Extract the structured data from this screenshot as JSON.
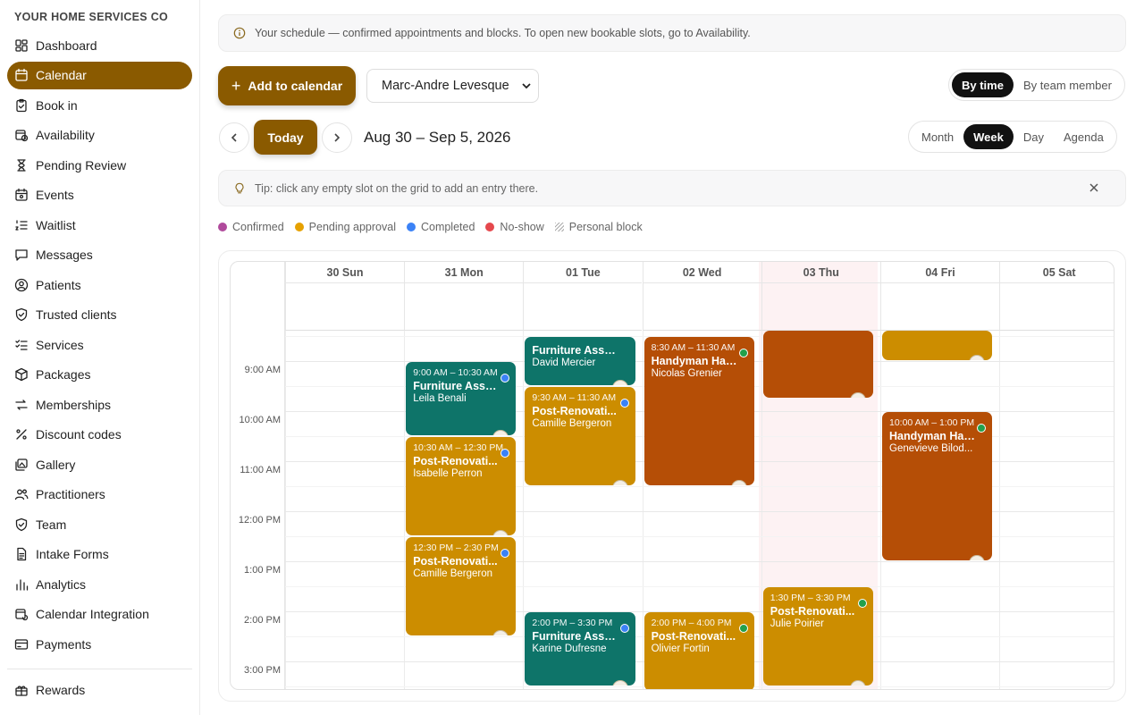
{
  "brand": "YOUR HOME SERVICES CO",
  "sidebar": {
    "items": [
      {
        "label": "Dashboard",
        "icon": "dashboard-icon"
      },
      {
        "label": "Calendar",
        "icon": "calendar-icon",
        "active": true
      },
      {
        "label": "Book in",
        "icon": "clipboard-icon"
      },
      {
        "label": "Availability",
        "icon": "calendar-clock-icon"
      },
      {
        "label": "Pending Review",
        "icon": "hourglass-icon"
      },
      {
        "label": "Events",
        "icon": "calendar-star-icon"
      },
      {
        "label": "Waitlist",
        "icon": "list-ordered-icon"
      },
      {
        "label": "Messages",
        "icon": "chat-icon"
      },
      {
        "label": "Patients",
        "icon": "user-circle-icon"
      },
      {
        "label": "Trusted clients",
        "icon": "shield-check-icon"
      },
      {
        "label": "Services",
        "icon": "list-check-icon"
      },
      {
        "label": "Packages",
        "icon": "package-icon"
      },
      {
        "label": "Memberships",
        "icon": "repeat-icon"
      },
      {
        "label": "Discount codes",
        "icon": "percent-icon"
      },
      {
        "label": "Gallery",
        "icon": "images-icon"
      },
      {
        "label": "Practitioners",
        "icon": "users-icon"
      },
      {
        "label": "Team",
        "icon": "shield-icon"
      },
      {
        "label": "Intake Forms",
        "icon": "document-icon"
      },
      {
        "label": "Analytics",
        "icon": "bar-chart-icon"
      },
      {
        "label": "Calendar Integration",
        "icon": "calendar-sync-icon"
      },
      {
        "label": "Payments",
        "icon": "credit-card-icon"
      }
    ],
    "footer_items": [
      {
        "label": "Rewards",
        "icon": "gift-icon"
      }
    ]
  },
  "info": "Your schedule — confirmed appointments and blocks. To open new bookable slots, go to Availability.",
  "toolbar": {
    "add_label": "Add to calendar",
    "practitioner": "Marc-Andre Levesque",
    "view_mode": [
      "By time",
      "By team member"
    ],
    "view_mode_selected": "By time",
    "today_label": "Today",
    "range": "Aug 30 – Sep 5, 2026",
    "views": [
      "Month",
      "Week",
      "Day",
      "Agenda"
    ],
    "view_selected": "Week"
  },
  "tip": "Tip: click any empty slot on the grid to add an entry there.",
  "legend": [
    {
      "label": "Confirmed",
      "color": "#b04a9c",
      "kind": "dot"
    },
    {
      "label": "Pending approval",
      "color": "#e6a100",
      "kind": "dot"
    },
    {
      "label": "Completed",
      "color": "#3b82f6",
      "kind": "dot"
    },
    {
      "label": "No-show",
      "color": "#e5484d",
      "kind": "dot"
    },
    {
      "label": "Personal block",
      "color": "#aaaaaa",
      "kind": "hatch"
    }
  ],
  "calendar": {
    "days": [
      "30 Sun",
      "31 Mon",
      "01 Tue",
      "02 Wed",
      "03 Thu",
      "04 Fri",
      "05 Sat"
    ],
    "today_index": 4,
    "times": [
      "9:00 AM",
      "10:00 AM",
      "11:00 AM",
      "12:00 PM",
      "1:00 PM",
      "2:00 PM",
      "3:00 PM"
    ],
    "colors": {
      "teal": "#0e7469",
      "gold": "#cc8d00",
      "rust": "#b54e06"
    },
    "status_colors": {
      "completed": "#3b82f6",
      "confirmed": "#22a04b"
    },
    "events": [
      {
        "day": 1,
        "start": 9.0,
        "end": 10.5,
        "time": "9:00 AM – 10:30 AM",
        "service": "Furniture Asse...",
        "client": "Leila Benali",
        "color": "teal",
        "status": "completed"
      },
      {
        "day": 1,
        "start": 10.5,
        "end": 12.5,
        "time": "10:30 AM – 12:30 PM",
        "service": "Post-Renovati...",
        "client": "Isabelle Perron",
        "color": "gold",
        "status": "completed"
      },
      {
        "day": 1,
        "start": 12.5,
        "end": 14.5,
        "time": "12:30 PM – 2:30 PM",
        "service": "Post-Renovati...",
        "client": "Camille Bergeron",
        "color": "gold",
        "status": "completed"
      },
      {
        "day": 2,
        "start": 8.5,
        "end": 9.5,
        "time": "",
        "service": "Furniture Asse...",
        "client": "David Mercier",
        "color": "teal",
        "status": ""
      },
      {
        "day": 2,
        "start": 9.5,
        "end": 11.5,
        "time": "9:30 AM – 11:30 AM",
        "service": "Post-Renovati...",
        "client": "Camille Bergeron",
        "color": "gold",
        "status": "completed"
      },
      {
        "day": 2,
        "start": 14.0,
        "end": 15.5,
        "time": "2:00 PM – 3:30 PM",
        "service": "Furniture Asse...",
        "client": "Karine Dufresne",
        "color": "teal",
        "status": "completed"
      },
      {
        "day": 3,
        "start": 8.5,
        "end": 11.5,
        "time": "8:30 AM – 11:30 AM",
        "service": "Handyman Hal...",
        "client": "Nicolas Grenier",
        "color": "rust",
        "status": "confirmed"
      },
      {
        "day": 3,
        "start": 14.0,
        "end": 16.0,
        "time": "2:00 PM – 4:00 PM",
        "service": "Post-Renovati...",
        "client": "Olivier Fortin",
        "color": "gold",
        "status": "confirmed"
      },
      {
        "day": 4,
        "start": 8.0,
        "end": 9.75,
        "time": "",
        "service": "",
        "client": "",
        "color": "rust",
        "status": ""
      },
      {
        "day": 4,
        "start": 13.5,
        "end": 15.5,
        "time": "1:30 PM – 3:30 PM",
        "service": "Post-Renovati...",
        "client": "Julie Poirier",
        "color": "gold",
        "status": "confirmed"
      },
      {
        "day": 5,
        "start": 8.0,
        "end": 9.0,
        "time": "",
        "service": "",
        "client": "",
        "color": "gold",
        "status": ""
      },
      {
        "day": 5,
        "start": 10.0,
        "end": 13.0,
        "time": "10:00 AM – 1:00 PM",
        "service": "Handyman Hal...",
        "client": "Genevieve Bilod...",
        "color": "rust",
        "status": "confirmed"
      }
    ]
  }
}
